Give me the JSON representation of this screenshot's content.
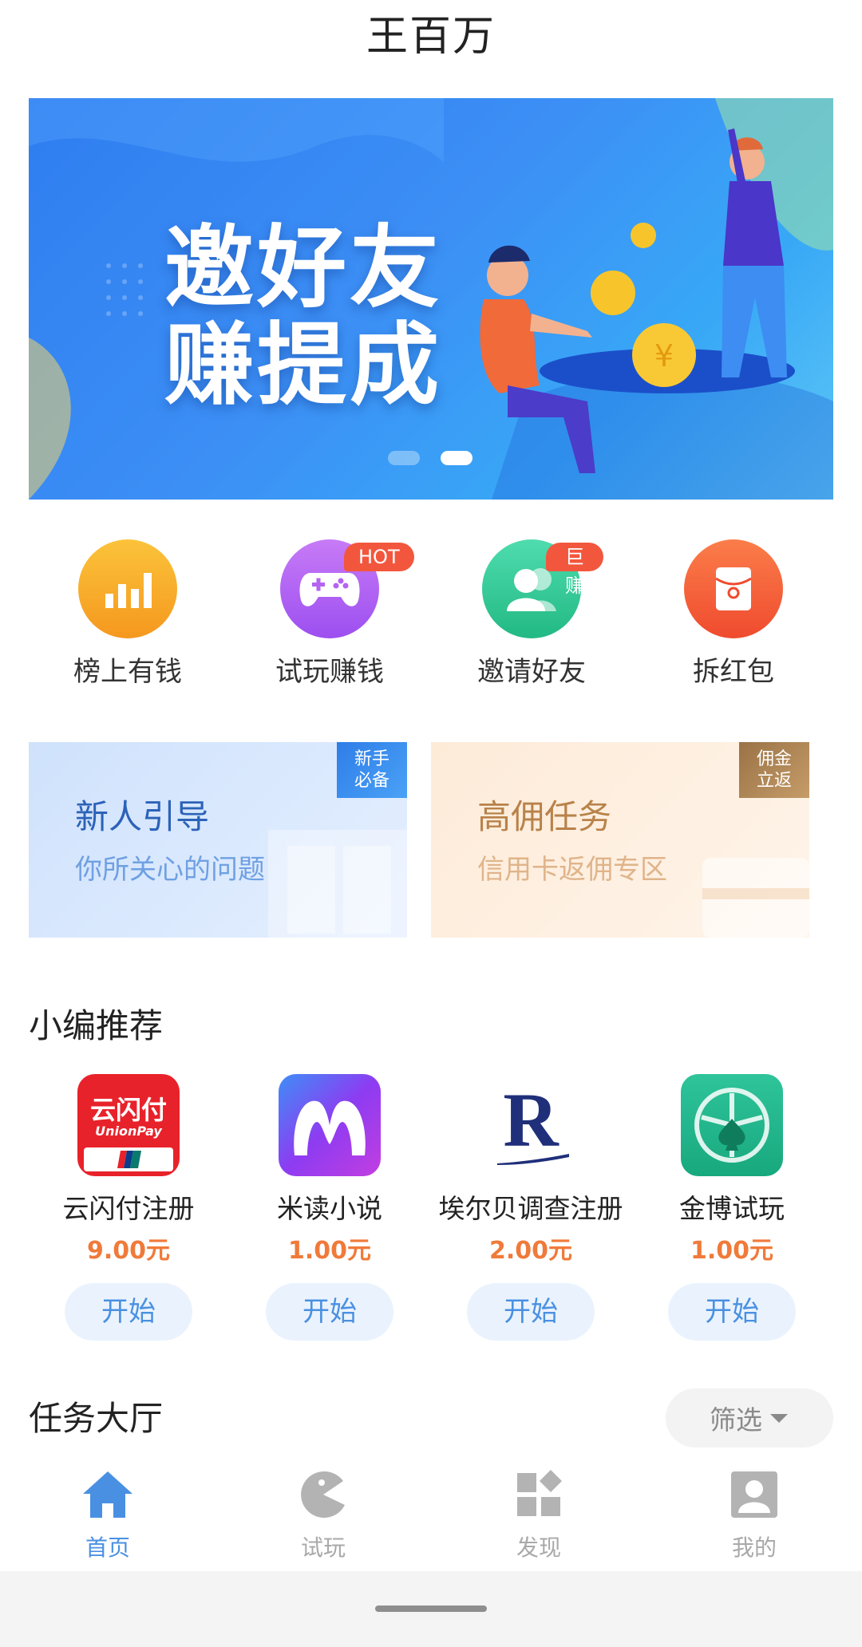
{
  "header": {
    "title": "王百万"
  },
  "banner": {
    "line1": "邀好友",
    "line2": "赚提成",
    "active_slide": 2,
    "slide_count": 2
  },
  "quick_menu": [
    {
      "label": "榜上有钱",
      "icon": "bar-chart-icon",
      "color": "#f9a826",
      "badge": ""
    },
    {
      "label": "试玩赚钱",
      "icon": "gamepad-icon",
      "color": "#b463f2",
      "badge": "HOT"
    },
    {
      "label": "邀请好友",
      "icon": "users-icon",
      "color": "#36cf9c",
      "badge": "巨赚"
    },
    {
      "label": "拆红包",
      "icon": "red-envelope-icon",
      "color": "#f4633b",
      "badge": ""
    }
  ],
  "promo": {
    "newbie": {
      "title": "新人引导",
      "subtitle": "你所关心的问题",
      "tag_line1": "新手",
      "tag_line2": "必备"
    },
    "commission": {
      "title": "高佣任务",
      "subtitle": "信用卡返佣专区",
      "tag_line1": "佣金",
      "tag_line2": "立返"
    }
  },
  "recommend": {
    "title": "小编推荐",
    "items": [
      {
        "name": "云闪付注册",
        "price": "9.00元",
        "button": "开始",
        "icon": "unionpay-app-icon",
        "icon_text": "云闪付",
        "icon_subtext": "UnionPay"
      },
      {
        "name": "米读小说",
        "price": "1.00元",
        "button": "开始",
        "icon": "midu-app-icon"
      },
      {
        "name": "埃尔贝调查注册",
        "price": "2.00元",
        "button": "开始",
        "icon": "letter-r-app-icon",
        "icon_text": "R"
      },
      {
        "name": "金博试玩",
        "price": "1.00元",
        "button": "开始",
        "icon": "spade-app-icon"
      }
    ]
  },
  "task_hall": {
    "title": "任务大厅",
    "filter_label": "筛选"
  },
  "bottom_nav": [
    {
      "label": "首页",
      "icon": "home-icon",
      "active": true
    },
    {
      "label": "试玩",
      "icon": "pacman-icon",
      "active": false
    },
    {
      "label": "发现",
      "icon": "apps-icon",
      "active": false
    },
    {
      "label": "我的",
      "icon": "profile-icon",
      "active": false
    }
  ],
  "colors": {
    "accent": "#4a90e2",
    "price": "#f07a3a",
    "nav_inactive": "#a9a9a9"
  }
}
